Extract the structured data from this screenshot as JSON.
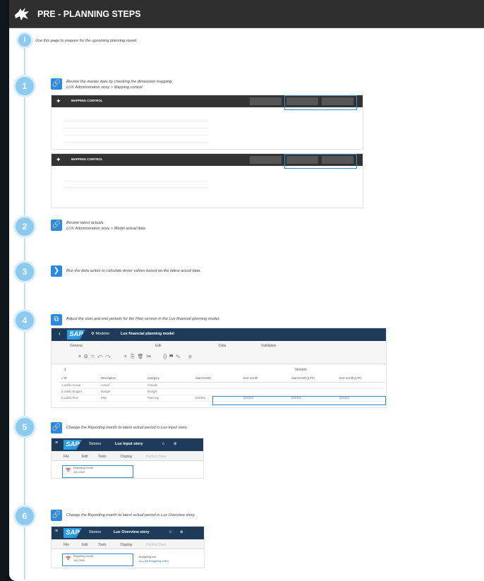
{
  "header": {
    "title": "PRE - PLANNING STEPS"
  },
  "intro": {
    "text": "Use this page to prepare for the upcoming planning round."
  },
  "steps": [
    {
      "num": "1",
      "text1": "Review the master data by checking the dimension mapping.",
      "text2": "LUX Administration story > Mapping control"
    },
    {
      "num": "2",
      "text1": "Review latest actuals.",
      "text2": "LUX Administration story > Model actual data"
    },
    {
      "num": "3",
      "text1": "Run the data action to calculate driver values based on the latest actual data."
    },
    {
      "num": "4",
      "text1": "Adjust the start and end periods for the Plan version in the Lux financial planning model."
    },
    {
      "num": "5",
      "text1": "Change the Reporting month to latest actual period in Lux Input story."
    },
    {
      "num": "6",
      "text1": "Change the Reporting month to latest actual period in Lux Overview story."
    }
  ],
  "mapping": {
    "title": "MAPPING CONTROL"
  },
  "modeler": {
    "sap": "SAP",
    "modeler_label": "Modeler",
    "model_name": "Lux financial planning model",
    "groups": [
      "General",
      "Edit",
      "Data",
      "Validation"
    ],
    "version_label": "Version",
    "columns": [
      "ID",
      "Description",
      "Category",
      "Start month",
      "End month",
      "Start month (LTF)",
      "End month (LTF)"
    ],
    "rows": [
      {
        "n": "1",
        "id": "public.Actual",
        "desc": "Actual",
        "cat": "Actuals",
        "sm": "",
        "em": "",
        "sl": "",
        "el": ""
      },
      {
        "n": "2",
        "id": "public.Budget",
        "desc": "Budget",
        "cat": "Budget",
        "sm": "",
        "em": "",
        "sl": "",
        "el": ""
      },
      {
        "n": "3",
        "id": "public.Plan",
        "desc": "Plan",
        "cat": "Planning",
        "sm": "202403",
        "em": "202412",
        "sl": "202401",
        "el": "202412"
      }
    ]
  },
  "input_story": {
    "sap": "SAP",
    "stories": "Stories",
    "name": "Lux Input story",
    "menus": [
      "File",
      "Edit",
      "Tools",
      "Display",
      "Publish Data"
    ],
    "filter_label": "Reporting month",
    "filter_value": "JUL 2024"
  },
  "overview_story": {
    "sap": "SAP",
    "stories": "Stories",
    "name": "Lux Overview story",
    "menus": [
      "File",
      "Edit",
      "Tools",
      "Display",
      "Publish Data"
    ],
    "filter_label": "Reporting month",
    "filter_value": "JUL 2024",
    "filter2_label": "Budgeting unit",
    "filter2_value": "ALL (All Budgeting units)"
  }
}
